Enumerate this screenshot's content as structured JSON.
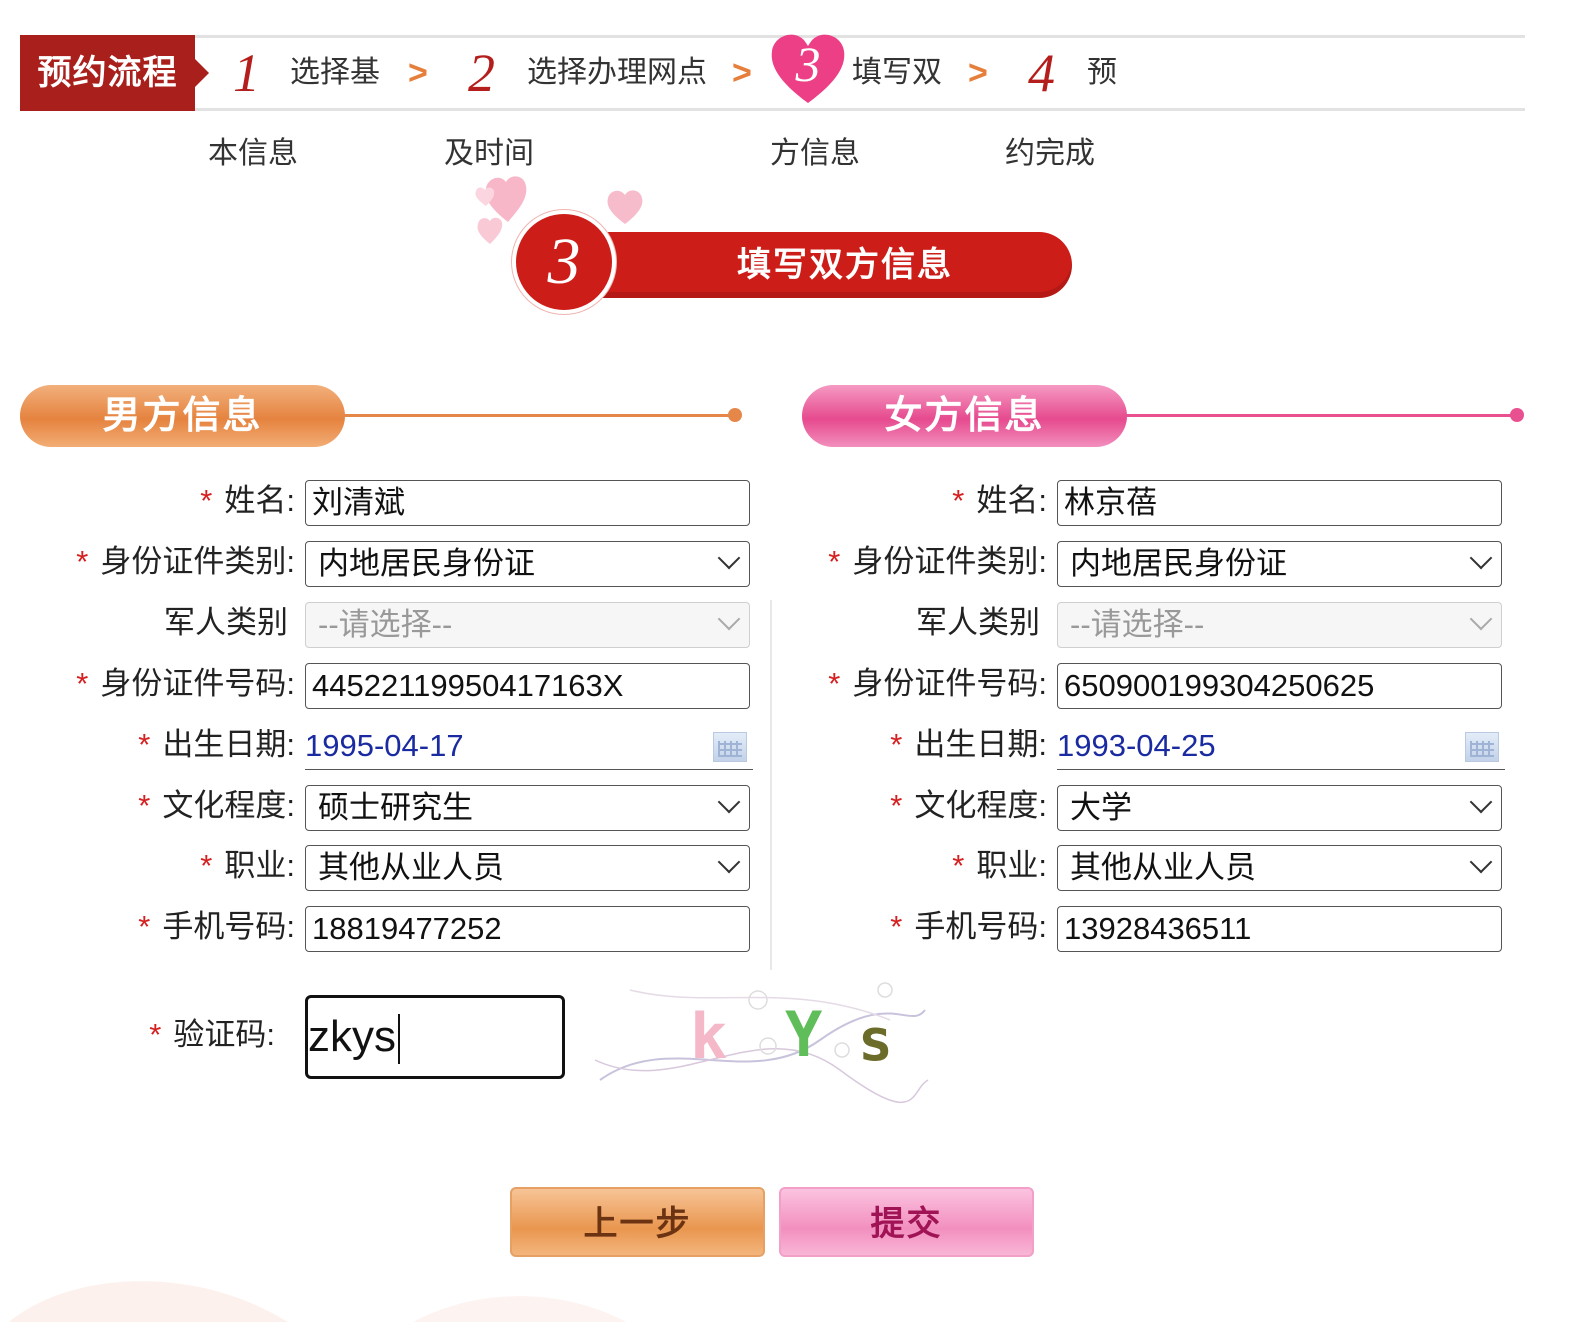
{
  "stepbar": {
    "title": "预约流程",
    "steps": [
      {
        "num": "1",
        "line1": "选择基",
        "line2": "本信息"
      },
      {
        "num": "2",
        "line1": "选择办理网点",
        "line2": "及时间"
      },
      {
        "num": "3",
        "line1": "填写双",
        "line2": "方信息"
      },
      {
        "num": "4",
        "line1": "预",
        "line2": "约完成"
      }
    ],
    "chevron": ">"
  },
  "banner": {
    "num": "3",
    "label": "填写双方信息"
  },
  "male": {
    "header": "男方信息",
    "name_label": "姓名:",
    "name": "刘清斌",
    "idtype_label": "身份证件类别:",
    "idtype": "内地居民身份证",
    "military_label": "军人类别",
    "military": "--请选择--",
    "idnum_label": "身份证件号码:",
    "idnum": "44522119950417163X",
    "birth_label": "出生日期:",
    "birth": "1995-04-17",
    "edu_label": "文化程度:",
    "edu": "硕士研究生",
    "job_label": "职业:",
    "job": "其他从业人员",
    "phone_label": "手机号码:",
    "phone": "18819477252"
  },
  "female": {
    "header": "女方信息",
    "name_label": "姓名:",
    "name": "林京蓓",
    "idtype_label": "身份证件类别:",
    "idtype": "内地居民身份证",
    "military_label": "军人类别",
    "military": "--请选择--",
    "idnum_label": "身份证件号码:",
    "idnum": "650900199304250625",
    "birth_label": "出生日期:",
    "birth": "1993-04-25",
    "edu_label": "文化程度:",
    "edu": "大学",
    "job_label": "职业:",
    "job": "其他从业人员",
    "phone_label": "手机号码:",
    "phone": "13928436511"
  },
  "captcha": {
    "label": "验证码:",
    "value": "zkys",
    "image_chars": [
      "k",
      "Y",
      "s"
    ]
  },
  "buttons": {
    "prev": "上一步",
    "submit": "提交"
  },
  "colors": {
    "brand_red": "#cd1d18",
    "male_orange": "#e5833f",
    "female_pink": "#e64a8e",
    "required": "#d62020",
    "date_blue": "#1a2aa0"
  }
}
